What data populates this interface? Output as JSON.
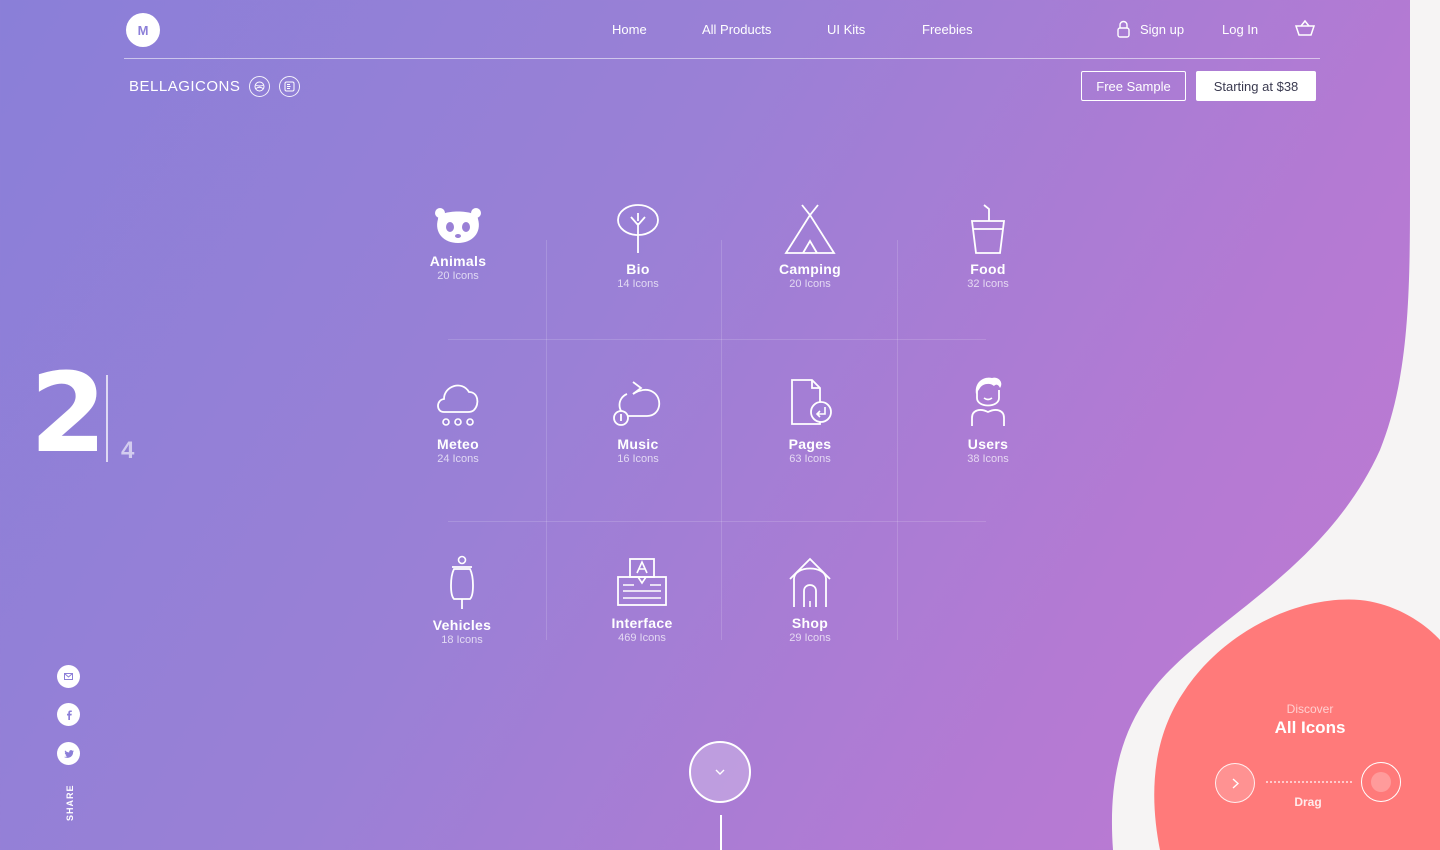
{
  "header": {
    "logo_letter": "M",
    "nav": {
      "home": "Home",
      "all_products": "All Products",
      "ui_kits": "UI Kits",
      "freebies": "Freebies"
    },
    "signup": "Sign up",
    "login": "Log In"
  },
  "product": {
    "name": "BELLAGICONS",
    "free_sample": "Free Sample",
    "buy": "Starting at $38"
  },
  "pager": {
    "current": "2",
    "total": "4"
  },
  "categories": [
    {
      "name": "Animals",
      "count": "20 Icons",
      "icon": "panda-icon"
    },
    {
      "name": "Bio",
      "count": "14 Icons",
      "icon": "tree-icon"
    },
    {
      "name": "Camping",
      "count": "20 Icons",
      "icon": "tent-icon"
    },
    {
      "name": "Food",
      "count": "32 Icons",
      "icon": "drink-cup-icon"
    },
    {
      "name": "Meteo",
      "count": "24 Icons",
      "icon": "cloud-icon"
    },
    {
      "name": "Music",
      "count": "16 Icons",
      "icon": "repeat-icon"
    },
    {
      "name": "Pages",
      "count": "63 Icons",
      "icon": "page-icon"
    },
    {
      "name": "Users",
      "count": "38 Icons",
      "icon": "user-icon"
    },
    {
      "name": "Vehicles",
      "count": "18 Icons",
      "icon": "scooter-icon"
    },
    {
      "name": "Interface",
      "count": "469 Icons",
      "icon": "keyboard-icon"
    },
    {
      "name": "Shop",
      "count": "29 Icons",
      "icon": "shop-icon"
    }
  ],
  "share": {
    "label": "SHARE"
  },
  "discover": {
    "label": "Discover",
    "title": "All Icons",
    "drag": "Drag"
  },
  "colors": {
    "accent_coral": "#ff7a7a",
    "off_white": "#f6f4f4"
  }
}
